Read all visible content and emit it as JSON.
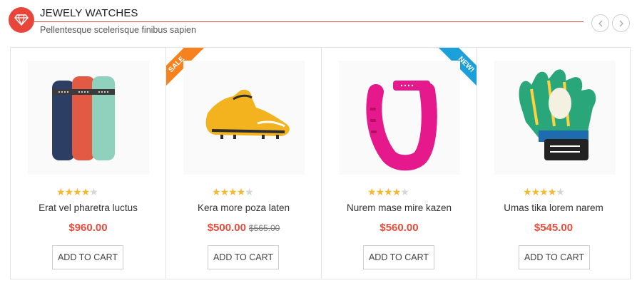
{
  "section": {
    "title": "JEWELY WATCHES",
    "subtitle": "Pellentesque scelerisque finibus sapien",
    "title_icon": "gem-icon",
    "accent_color": "#e8463a"
  },
  "navigation": {
    "prev_icon": "chevron-left-icon",
    "next_icon": "chevron-right-icon"
  },
  "products": [
    {
      "name": "Erat vel pharetra luctus",
      "price": "$960.00",
      "old_price": "",
      "rating": 4,
      "rating_max": 5,
      "badge": "",
      "image": "fitness-band-set-image",
      "cart_label": "ADD TO CART"
    },
    {
      "name": "Kera more poza laten",
      "price": "$500.00",
      "old_price": "$565.00",
      "rating": 4,
      "rating_max": 5,
      "badge": "SALE",
      "image": "football-boot-image",
      "cart_label": "ADD TO CART"
    },
    {
      "name": "Nurem mase mire kazen",
      "price": "$560.00",
      "old_price": "",
      "rating": 4,
      "rating_max": 5,
      "badge": "NEW!",
      "image": "pink-fitness-band-image",
      "cart_label": "ADD TO CART"
    },
    {
      "name": "Umas tika lorem narem",
      "price": "$545.00",
      "old_price": "",
      "rating": 4,
      "rating_max": 5,
      "badge": "",
      "image": "goalkeeper-glove-image",
      "cart_label": "ADD TO CART"
    }
  ],
  "colors": {
    "price": "#e74c3c",
    "star_on": "#f5b82e",
    "star_off": "#d6d6d6",
    "sale_badge": "#f6821f",
    "new_badge": "#1ba0d9"
  }
}
